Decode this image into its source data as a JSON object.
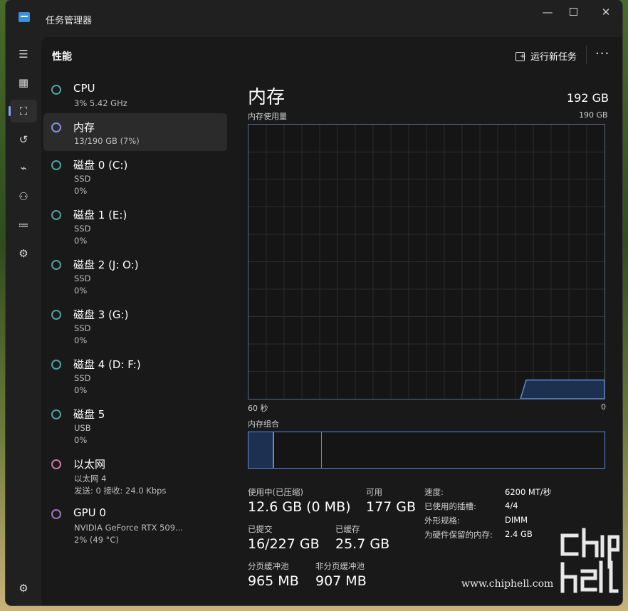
{
  "window": {
    "title": "任务管理器"
  },
  "header": {
    "title": "性能",
    "new_task_label": "运行新任务"
  },
  "rail": {
    "icons": [
      "menu-icon",
      "processes-icon",
      "performance-icon",
      "app-history-icon",
      "startup-icon",
      "users-icon",
      "details-icon",
      "services-icon",
      "settings-icon"
    ]
  },
  "list": [
    {
      "name": "CPU",
      "sub": "3%  5.42 GHz",
      "sub2": ""
    },
    {
      "name": "内存",
      "sub": "13/190 GB (7%)",
      "sub2": ""
    },
    {
      "name": "磁盘 0 (C:)",
      "sub": "SSD",
      "sub2": "0%"
    },
    {
      "name": "磁盘 1 (E:)",
      "sub": "SSD",
      "sub2": "0%"
    },
    {
      "name": "磁盘 2 (J: O:)",
      "sub": "SSD",
      "sub2": "0%"
    },
    {
      "name": "磁盘 3 (G:)",
      "sub": "SSD",
      "sub2": "0%"
    },
    {
      "name": "磁盘 4 (D: F:)",
      "sub": "SSD",
      "sub2": "0%"
    },
    {
      "name": "磁盘 5",
      "sub": "USB",
      "sub2": "0%"
    },
    {
      "name": "以太网",
      "sub": "以太网 4",
      "sub2": "发送: 0 接收: 24.0 Kbps"
    },
    {
      "name": "GPU 0",
      "sub": "NVIDIA GeForce RTX 509...",
      "sub2": "2% (49 °C)"
    }
  ],
  "detail": {
    "title": "内存",
    "total": "192 GB",
    "usage_label": "内存使用量",
    "usage_max": "190 GB",
    "x_left": "60 秒",
    "x_right": "0",
    "composition_label": "内存组合",
    "in_use_label": "使用中(已压缩)",
    "in_use_value": "12.6 GB (0 MB)",
    "available_label": "可用",
    "available_value": "177 GB",
    "committed_label": "已提交",
    "committed_value": "16/227 GB",
    "cached_label": "已缓存",
    "cached_value": "25.7 GB",
    "paged_label": "分页缓冲池",
    "paged_value": "965 MB",
    "nonpaged_label": "非分页缓冲池",
    "nonpaged_value": "907 MB",
    "speed_label": "速度:",
    "speed_value": "6200 MT/秒",
    "slots_label": "已使用的插槽:",
    "slots_value": "4/4",
    "form_label": "外形规格:",
    "form_value": "DIMM",
    "reserved_label": "为硬件保留的内存:",
    "reserved_value": "2.4 GB"
  },
  "usage_graph": {
    "max_gb": 190,
    "recent_gb": 13,
    "rise_fraction_of_window": 0.22
  },
  "watermark": "www.chiphell.com",
  "colors": {
    "accent": "#7aa7ff",
    "graph_border": "#5a8ad8",
    "graph_fill": "#1e3050"
  }
}
